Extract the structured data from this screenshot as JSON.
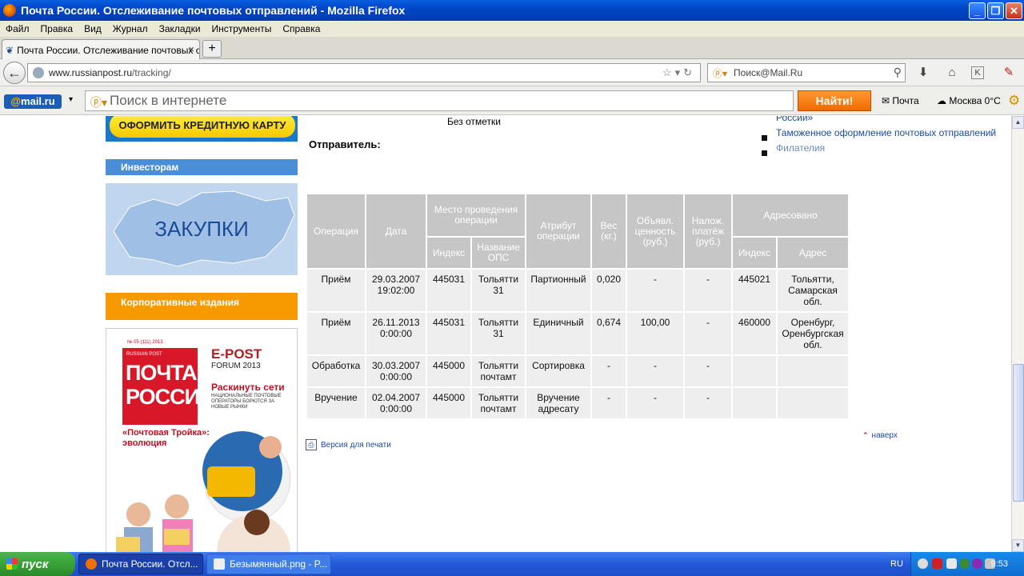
{
  "window": {
    "title": "Почта России. Отслеживание почтовых отправлений - Mozilla Firefox"
  },
  "menu": [
    "Файл",
    "Правка",
    "Вид",
    "Журнал",
    "Закладки",
    "Инструменты",
    "Справка"
  ],
  "tab": {
    "label": "Почта России. Отслеживание почтовых о...",
    "new_tab": "+"
  },
  "navbar": {
    "url_host": "www.russianpost.ru",
    "url_path": "/tracking/",
    "search_placeholder": "Поиск@Mail.Ru"
  },
  "mailbar": {
    "logo_at": "@",
    "logo_text": "mail.ru",
    "search_placeholder": "Поиск в интернете",
    "find_button": "Найти!",
    "mail_link": "Почта",
    "weather": "Москва 0°C"
  },
  "sidebar": {
    "credit_banner": "ОФОРМИТЬ КРЕДИТНУЮ КАРТУ",
    "investors": "Инвесторам",
    "zakupki": "ЗАКУПКИ",
    "corporate": "Корпоративные издания",
    "magazine": {
      "issue": "№ 05 (111) 2013",
      "brand_small": "RUSSIAN POST",
      "title": "ПОЧТА РОССИИ",
      "epost": "E-POST",
      "forum": "FORUM 2013",
      "headline": "Раскинуть сети",
      "subline": "НАЦИОНАЛЬНЫЕ ПОЧТОВЫЕ ОПЕРАТОРЫ БОРЮТСЯ ЗА НОВЫЕ РЫНКИ",
      "trojka": "«Почтовая Тройка»: эволюция"
    }
  },
  "content": {
    "no_mark": "Без отметки",
    "sender_label": "Отправитель:",
    "right_links": [
      "России»",
      "Таможенное оформление почтовых отправлений",
      "Филателия"
    ],
    "table": {
      "headers": {
        "operation": "Операция",
        "date": "Дата",
        "place": "Место проведения операции",
        "place_index": "Индекс",
        "place_name": "Название ОПС",
        "attribute": "Атрибут операции",
        "weight": "Вес (кг.)",
        "declared": "Объявл. ценность (руб.)",
        "cod": "Налож. платёж (руб.)",
        "addressed": "Адресовано",
        "addr_index": "Индекс",
        "addr_address": "Адрес"
      },
      "rows": [
        {
          "op": "Приём",
          "date": "29.03.2007 19:02:00",
          "idx": "445031",
          "ops": "Тольятти 31",
          "attr": "Партионный",
          "weight": "0,020",
          "declared": "-",
          "cod": "-",
          "aidx": "445021",
          "addr": "Тольятти, Самарская обл."
        },
        {
          "op": "Приём",
          "date": "26.11.2013 0:00:00",
          "idx": "445031",
          "ops": "Тольятти 31",
          "attr": "Единичный",
          "weight": "0,674",
          "declared": "100,00",
          "cod": "-",
          "aidx": "460000",
          "addr": "Оренбург, Оренбургская обл."
        },
        {
          "op": "Обработка",
          "date": "30.03.2007 0:00:00",
          "idx": "445000",
          "ops": "Тольятти почтамт",
          "attr": "Сортировка",
          "weight": "-",
          "declared": "-",
          "cod": "-",
          "aidx": "",
          "addr": ""
        },
        {
          "op": "Вручение",
          "date": "02.04.2007 0:00:00",
          "idx": "445000",
          "ops": "Тольятти почтамт",
          "attr": "Вручение адресату",
          "weight": "-",
          "declared": "-",
          "cod": "-",
          "aidx": "",
          "addr": ""
        }
      ]
    },
    "print_link": "Версия для печати",
    "top_link": "наверх"
  },
  "taskbar": {
    "start": "пуск",
    "tasks": [
      "Почта России. Отсл...",
      "Безымянный.png - P..."
    ],
    "lang": "RU",
    "clock": "9:53"
  },
  "colors": {
    "table_header": "#c6c6c6",
    "table_cell": "#eeeeee",
    "link": "#1a4a9a",
    "investors": "#4a8ed8",
    "corporate": "#f59a00",
    "find_button": "#f06a00"
  }
}
